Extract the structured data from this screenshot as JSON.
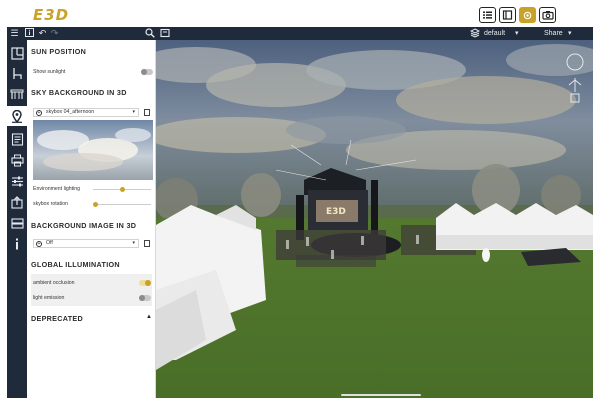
{
  "app": {
    "logo_text": "E3D"
  },
  "topbar": {
    "buttons": [
      {
        "icon": "list-icon",
        "active": false
      },
      {
        "icon": "layout-icon",
        "active": false
      },
      {
        "icon": "settings-gold-icon",
        "active": true
      },
      {
        "icon": "camera-icon",
        "active": false
      }
    ]
  },
  "toolbar": {
    "layer_label": "default",
    "share_label": "Share"
  },
  "panel": {
    "sun_position": {
      "title": "SUN POSITION",
      "show_sunlight_label": "Show sunlight",
      "show_sunlight_on": false
    },
    "sky_background": {
      "title": "SKY BACKGROUND IN 3D",
      "skybox_value": "skybox 04_afternoon",
      "environment_lighting_label": "Environment lighting",
      "environment_lighting_level": 0.5,
      "skybox_rotation_label": "skybox rotation",
      "skybox_rotation_level": 0.0
    },
    "background_image": {
      "title": "BACKGROUND IMAGE IN 3D",
      "value": "Off"
    },
    "global_illumination": {
      "title": "GLOBAL ILLUMINATION",
      "ambient_occlusion_label": "ambient occlusion",
      "ambient_occlusion_on": true,
      "light_emission_label": "light emission",
      "light_emission_on": false
    },
    "deprecated": {
      "title": "DEPRECATED"
    }
  },
  "viewport": {
    "stage_logo_text": "E3D"
  },
  "colors": {
    "accent": "#c9a227",
    "dark_chrome": "#1f2a3a",
    "grass": "#4f7a2c",
    "sky": "#3c5170"
  }
}
